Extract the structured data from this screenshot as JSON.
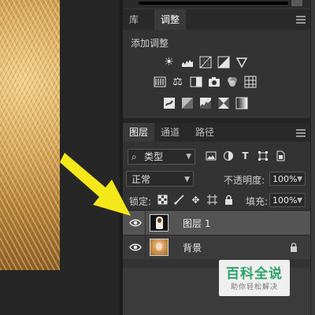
{
  "colors": {
    "panel": "#333333",
    "selected_layer": "#545454",
    "arrow": "#f5e81a",
    "watermark_text": "#2aa36a"
  },
  "adjustments_panel": {
    "tabs": [
      "库",
      "调整"
    ],
    "active_tab": "调整",
    "section_label": "添加调整",
    "icon_rows": [
      [
        "brightness-contrast-icon",
        "levels-icon",
        "curves-icon",
        "exposure-icon",
        "gradient-triangle-icon"
      ],
      [
        "vibrance-icon",
        "color-balance-icon",
        "black-white-icon",
        "photo-filter-icon",
        "channel-mixer-icon",
        "color-lookup-icon"
      ],
      [
        "invert-icon",
        "posterize-icon",
        "threshold-icon",
        "selective-color-icon",
        "gradient-map-icon"
      ]
    ]
  },
  "layers_panel": {
    "tabs": [
      "图层",
      "通道",
      "路径"
    ],
    "active_tab": "图层",
    "filter_label": "类型",
    "blend_mode": "正常",
    "opacity_label": "不透明度:",
    "opacity_value": "100%",
    "lock_label": "锁定:",
    "fill_label": "填充:",
    "fill_value": "100%",
    "layers": [
      {
        "name": "图层 1",
        "visible": true,
        "selected": true,
        "locked": false
      },
      {
        "name": "背景",
        "visible": true,
        "selected": false,
        "locked": true
      }
    ]
  },
  "watermark": {
    "title": "百科全说",
    "subtitle": "助你轻松解决"
  }
}
